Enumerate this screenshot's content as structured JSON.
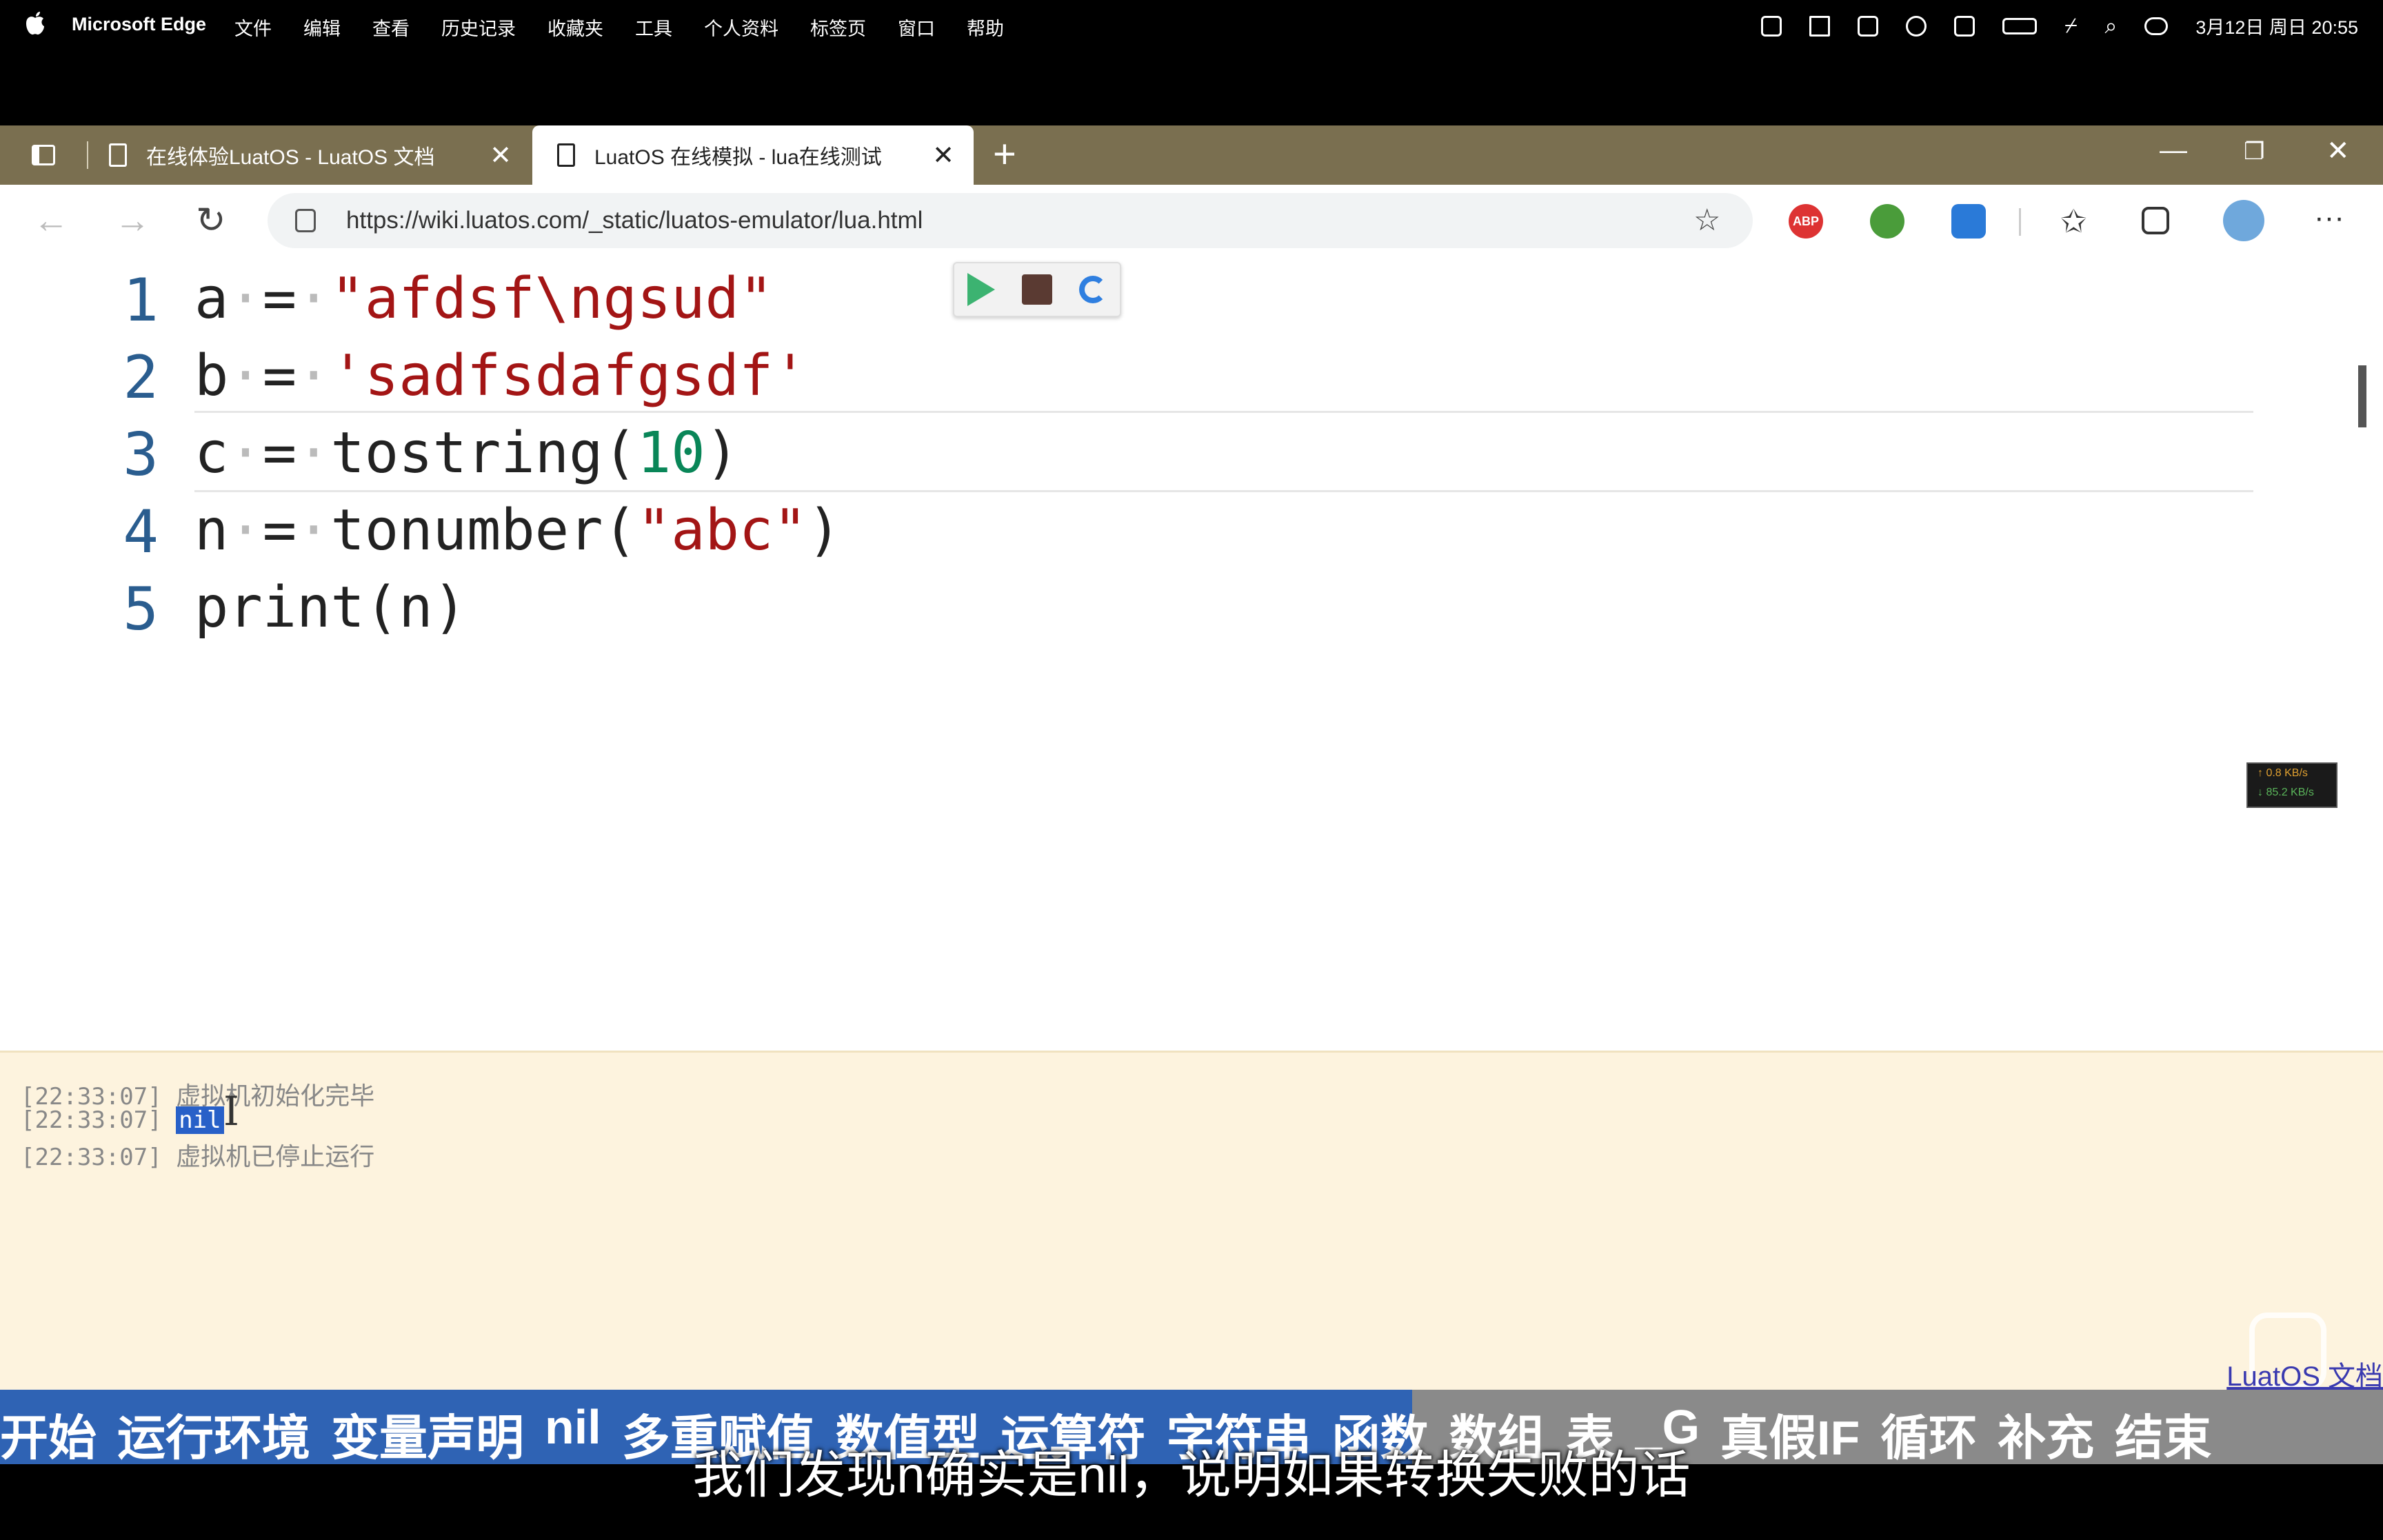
{
  "menubar": {
    "app_name": "Microsoft Edge",
    "menus": [
      "文件",
      "编辑",
      "查看",
      "历史记录",
      "收藏夹",
      "工具",
      "个人资料",
      "标签页",
      "窗口",
      "帮助"
    ],
    "clock": "3月12日 周日 20:55"
  },
  "tabs": [
    {
      "title": "在线体验LuatOS - LuatOS 文档",
      "active": false
    },
    {
      "title": "LuatOS 在线模拟 - lua在线测试",
      "active": true
    }
  ],
  "address_bar": {
    "url": "https://wiki.luatos.com/_static/luatos-emulator/lua.html"
  },
  "editor": {
    "line_numbers": [
      "1",
      "2",
      "3",
      "4",
      "5"
    ],
    "lines": {
      "l1_var": "a",
      "l1_str": "\"afdsf\\ngsud\"",
      "l2_var": "b",
      "l2_str": "'sadfsdafgsdf'",
      "l3_pre": "c",
      "l3_fn": "tostring(",
      "l3_num": "10",
      "l3_close": ")",
      "l4_pre": "n",
      "l4_fn": "tonumber(",
      "l4_str": "\"abc\"",
      "l4_close": ")",
      "l5": "print(n)"
    },
    "toolbar": {
      "run_icon": "play-icon",
      "stop_icon": "stop-icon",
      "reload_icon": "reload-icon"
    }
  },
  "net_speed": {
    "up": "↑ 0.8 KB/s",
    "down": "↓ 85.2 KB/s"
  },
  "console": {
    "lines": [
      {
        "time": "[22:33:07]",
        "msg": "虚拟机初始化完毕"
      },
      {
        "time": "[22:33:07]",
        "msg": "nil"
      },
      {
        "time": "[22:33:07]",
        "msg": "虚拟机已停止运行"
      }
    ],
    "footer_link": "LuatOS 文档"
  },
  "video": {
    "chapters": [
      "开始",
      "运行环境",
      "变量声明",
      "nil",
      "多重赋值",
      "数值型",
      "运算符",
      "字符串",
      "函数",
      "数组",
      "表",
      "_G",
      "真假IF",
      "循环",
      "补充",
      "结束"
    ],
    "subtitle": "我们发现n确实是nil，说明如果转换失败的话"
  },
  "colors": {
    "tabstrip": "#7a6f50",
    "chapter_done": "#2f63b4",
    "console_bg": "#fdf3de",
    "string": "#a31515",
    "number": "#098658"
  }
}
